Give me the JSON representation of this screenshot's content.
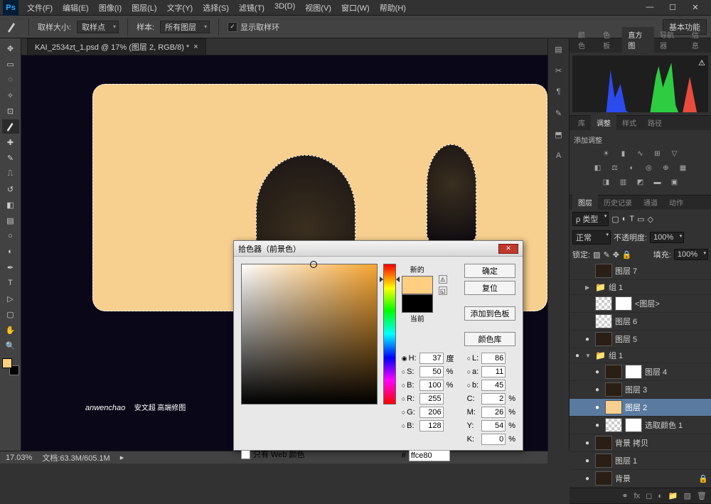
{
  "menu": [
    "文件(F)",
    "编辑(E)",
    "图像(I)",
    "图层(L)",
    "文字(Y)",
    "选择(S)",
    "滤镜(T)",
    "3D(D)",
    "视图(V)",
    "窗口(W)",
    "帮助(H)"
  ],
  "options": {
    "sample_size_label": "取样大小:",
    "sample_size_value": "取样点",
    "sample_label": "样本:",
    "sample_value": "所有图层",
    "show_sampling_ring": "显示取样环",
    "right_button": "基本功能"
  },
  "doc_tab": {
    "title": "KAI_2534zt_1.psd @ 17% (图层 2, RGB/8) *"
  },
  "watermark": {
    "name": "anwenchao",
    "sub": "安文超 高端修图"
  },
  "panel_tabs": {
    "top": [
      "颜色",
      "色板",
      "直方图",
      "导航器",
      "信息"
    ],
    "mid": [
      "库",
      "调整",
      "样式",
      "路径"
    ],
    "layers": [
      "图层",
      "历史记录",
      "通道",
      "动作"
    ]
  },
  "adjustments": {
    "title": "添加调整"
  },
  "layer_controls": {
    "kind": "ρ 类型",
    "blend_mode": "正常",
    "opacity_label": "不透明度:",
    "opacity_value": "100%",
    "lock_label": "锁定:",
    "fill_label": "填充:",
    "fill_value": "100%"
  },
  "layers": [
    {
      "eye": "",
      "name": "图层 7",
      "indent": 1,
      "thumb": "dark"
    },
    {
      "eye": "",
      "name": "组 1",
      "indent": 0,
      "folder": true,
      "twist": "▶"
    },
    {
      "eye": "",
      "name": "<图层>",
      "indent": 1,
      "thumb": "check",
      "mask": true
    },
    {
      "eye": "",
      "name": "图层 6",
      "indent": 1,
      "thumb": "check"
    },
    {
      "eye": "●",
      "name": "图层 5",
      "indent": 1,
      "thumb": "dark"
    },
    {
      "eye": "●",
      "name": "组 1",
      "indent": 0,
      "folder": true,
      "twist": "▼"
    },
    {
      "eye": "●",
      "name": "图层 4",
      "indent": 2,
      "thumb": "dark",
      "mask": true
    },
    {
      "eye": "●",
      "name": "图层 3",
      "indent": 2,
      "thumb": "dark"
    },
    {
      "eye": "●",
      "name": "图层 2",
      "indent": 2,
      "thumb": "warm",
      "selected": true
    },
    {
      "eye": "●",
      "name": "选取颜色 1",
      "indent": 2,
      "thumb": "check",
      "mask": true,
      "fx": true
    },
    {
      "eye": "●",
      "name": "背景 拷贝",
      "indent": 1,
      "thumb": "dark"
    },
    {
      "eye": "●",
      "name": "图层 1",
      "indent": 1,
      "thumb": "dark"
    },
    {
      "eye": "●",
      "name": "背景",
      "indent": 1,
      "thumb": "dark",
      "locked": true
    }
  ],
  "statusbar": {
    "zoom": "17.03%",
    "doc_info": "文档:63.3M/605.1M"
  },
  "color_picker": {
    "title": "拾色器（前景色）",
    "new_label": "新的",
    "current_label": "当前",
    "btn_ok": "确定",
    "btn_cancel": "复位",
    "btn_add": "添加到色板",
    "btn_lib": "颜色库",
    "web_only": "只有 Web 颜色",
    "values": {
      "H": "37",
      "H_unit": "度",
      "S": "50",
      "S_unit": "%",
      "Bv": "100",
      "Bv_unit": "%",
      "R": "255",
      "G": "206",
      "B": "128",
      "L": "86",
      "a": "11",
      "b": "45",
      "C": "2",
      "C_unit": "%",
      "M": "26",
      "M_unit": "%",
      "Y": "54",
      "Y_unit": "%",
      "K": "0",
      "K_unit": "%",
      "hex_label": "#",
      "hex": "ffce80"
    }
  }
}
